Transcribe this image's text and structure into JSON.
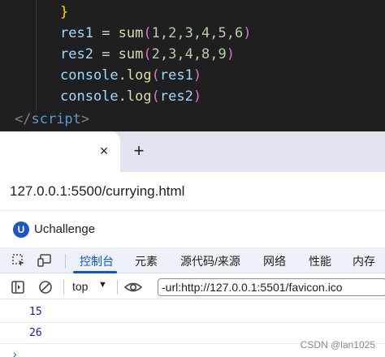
{
  "editor": {
    "closing_brace": "}",
    "line1": {
      "name": "res1",
      "eq": " = ",
      "fn": "sum",
      "open": "(",
      "args": "1,2,3,4,5,6",
      "close": ")"
    },
    "line2": {
      "name": "res2",
      "eq": " = ",
      "fn": "sum",
      "open": "(",
      "args": "2,3,4,8,9",
      "close": ")"
    },
    "line3": {
      "obj": "console",
      "dot": ".",
      "method": "log",
      "open": "(",
      "arg": "res1",
      "close": ")"
    },
    "line4": {
      "obj": "console",
      "dot": ".",
      "method": "log",
      "open": "(",
      "arg": "res2",
      "close": ")"
    },
    "close_tag": {
      "open": "</",
      "name": "script",
      "close": ">"
    }
  },
  "browser": {
    "tab_close_icon": "×",
    "new_tab_icon": "+",
    "url": "127.0.0.1:5500/currying.html",
    "bookmark": {
      "icon_letter": "U",
      "label": "Uchallenge"
    }
  },
  "devtools": {
    "tabs": [
      "控制台",
      "元素",
      "源代码/来源",
      "网络",
      "性能",
      "内存"
    ],
    "active_tab": "控制台"
  },
  "console": {
    "context": "top",
    "context_arrow": "▼",
    "filter_value": "-url:http://127.0.0.1:5501/favicon.ico",
    "outputs": [
      "15",
      "26"
    ],
    "prompt": "›",
    "watermark": "CSDN @lan1025"
  },
  "colors": {
    "editor_bg": "#1f1f1f",
    "accent": "#0b57d0",
    "console_number": "#1a1aa6"
  }
}
